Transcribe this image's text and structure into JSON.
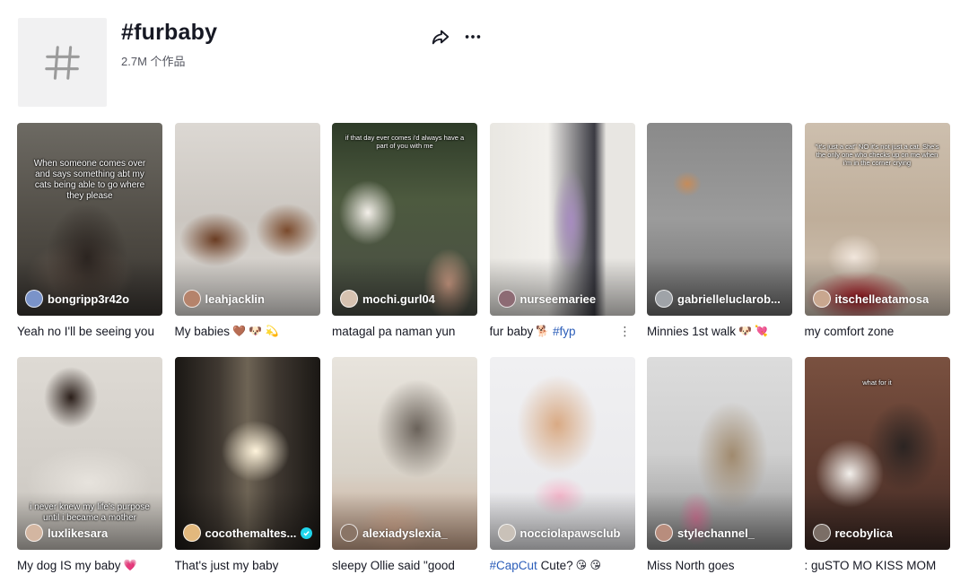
{
  "header": {
    "title": "#furbaby",
    "post_count": "2.7M 个作品",
    "hashtag_icon": "hashtag-icon",
    "share_icon": "share-icon",
    "more_icon": "more-icon"
  },
  "colors": {
    "text": "#161823",
    "secondary_text": "#555761",
    "link": "#2b5db9",
    "verified": "#20d5ec",
    "avatar_bg": "#f1f1f2"
  },
  "videos": [
    {
      "author": "bongripp3r42o",
      "caption_overlay": "When someone comes over and says something abt my cats being able to go where they please",
      "desc": "Yeah no I'll be seeing you",
      "tag": "",
      "emoji": ""
    },
    {
      "author": "leahjacklin",
      "caption_overlay": "",
      "desc": "My babies",
      "tag": "",
      "emoji": "🤎 🐶 💫"
    },
    {
      "author": "mochi.gurl04",
      "caption_overlay": "if that day ever comes i'd always have a part of you with me",
      "desc": "matagal pa naman yun",
      "tag": "",
      "emoji": ""
    },
    {
      "author": "nurseemariee",
      "caption_overlay": "",
      "desc": "fur baby",
      "tag": "#fyp",
      "emoji": "🐕"
    },
    {
      "author": "gabrielleluclarob...",
      "caption_overlay": "",
      "desc": "Minnies 1st walk",
      "tag": "",
      "emoji": "🐶 💘"
    },
    {
      "author": "itschelleatamosa",
      "caption_overlay": "\"it's just a cat\" NO it's not just a cat. She's the only one who checks up on me when i'm in the corner crying",
      "desc": "my comfort zone",
      "tag": "",
      "emoji": ""
    },
    {
      "author": "luxlikesara",
      "caption_overlay": "i never knew my life's purpose until i became a mother",
      "desc": "My dog IS my baby",
      "tag": "",
      "emoji": "💗"
    },
    {
      "author": "cocothemaltes...",
      "caption_overlay": "",
      "desc": "That's just my baby",
      "tag": "",
      "emoji": "",
      "verified": true
    },
    {
      "author": "alexiadyslexia_",
      "caption_overlay": "",
      "desc": "sleepy Ollie said \"good",
      "tag": "",
      "emoji": ""
    },
    {
      "author": "nocciolapawsclub",
      "caption_overlay": "",
      "desc": "Cute?",
      "tag": "#CapCut",
      "emoji": "😘 😘"
    },
    {
      "author": "stylechannel_",
      "caption_overlay": "",
      "desc": "Miss North goes",
      "tag": "",
      "emoji": ""
    },
    {
      "author": "recobylica",
      "caption_overlay": "what for it",
      "desc": ": guSTO MO KISS MOM",
      "tag": "",
      "emoji": ""
    }
  ]
}
